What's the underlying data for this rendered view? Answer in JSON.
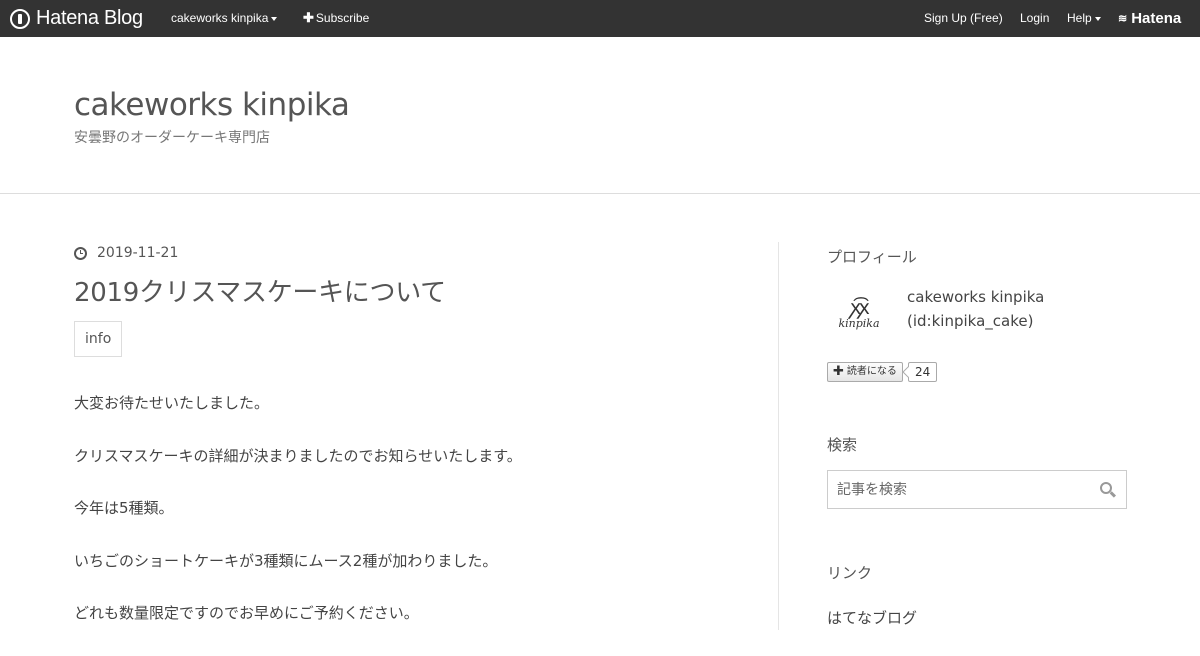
{
  "topbar": {
    "logo_text": "Hatena Blog",
    "blog_menu": "cakeworks kinpika",
    "subscribe": "Subscribe",
    "signup": "Sign Up (Free)",
    "login": "Login",
    "help": "Help",
    "brand": "Hatena"
  },
  "header": {
    "title": "cakeworks kinpika",
    "description": "安曇野のオーダーケーキ専門店"
  },
  "entry": {
    "date": "2019-11-21",
    "title": "2019クリスマスケーキについて",
    "category": "info",
    "paragraphs": [
      "大変お待たせいたしました。",
      "クリスマスケーキの詳細が決まりましたのでお知らせいたします。",
      "今年は5種類。",
      "いちごのショートケーキが3種類にムース2種が加わりました。",
      "どれも数量限定ですのでお早めにご予約ください。"
    ]
  },
  "sidebar": {
    "profile_heading": "プロフィール",
    "profile_name": "cakeworks kinpika",
    "profile_id": "(id:kinpika_cake)",
    "profile_image_text": "kinpika",
    "subscribe_label": "読者になる",
    "subscriber_count": "24",
    "search_heading": "検索",
    "search_placeholder": "記事を検索",
    "link_heading": "リンク",
    "links": [
      "はてなブログ"
    ]
  },
  "colors": {
    "topbar_bg": "#333333",
    "text": "#444444",
    "border": "#dddddd"
  }
}
